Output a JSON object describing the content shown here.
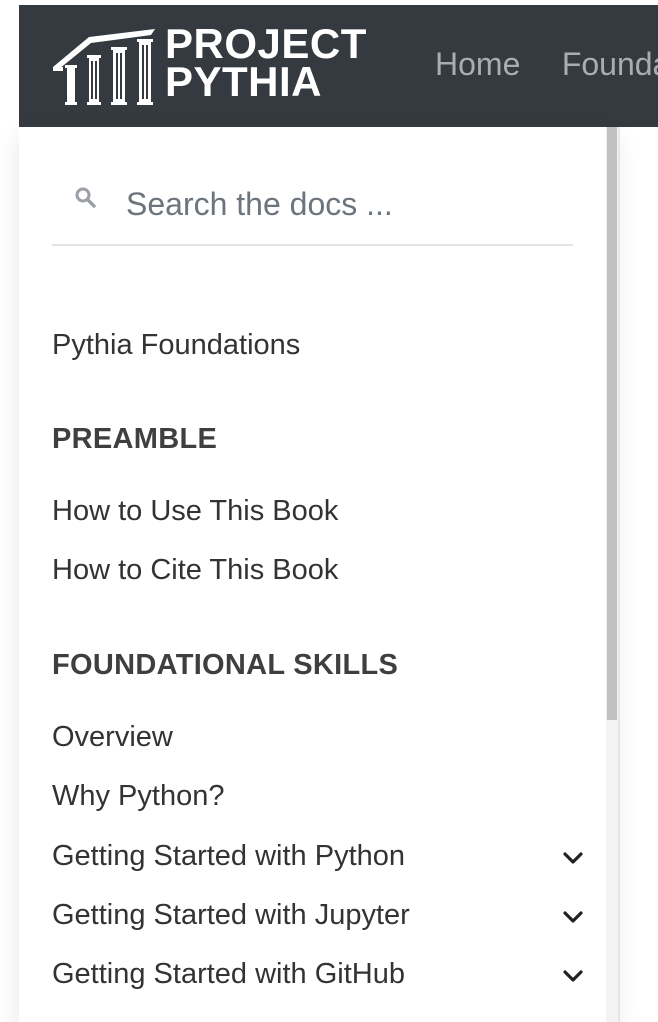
{
  "header": {
    "brand_line1": "PROJECT",
    "brand_line2": "PYTHIA",
    "nav_links": [
      "Home",
      "Foundations"
    ]
  },
  "search": {
    "placeholder": "Search the docs ..."
  },
  "sidebar": {
    "root_link": "Pythia Foundations",
    "sections": [
      {
        "caption": "PREAMBLE",
        "items": [
          "How to Use This Book",
          "How to Cite This Book"
        ]
      },
      {
        "caption": "FOUNDATIONAL SKILLS",
        "items": [
          "Overview",
          "Why Python?",
          "Getting Started with Python",
          "Getting Started with Jupyter",
          "Getting Started with GitHub"
        ]
      }
    ]
  },
  "icons": {
    "search": "search-icon",
    "expand": "chevron-down-icon",
    "logo": "pythia-columns-logo"
  },
  "colors": {
    "navbar": "#343a40",
    "nav_link": "#a9adb2",
    "text": "#333333",
    "muted": "#6c757d"
  }
}
